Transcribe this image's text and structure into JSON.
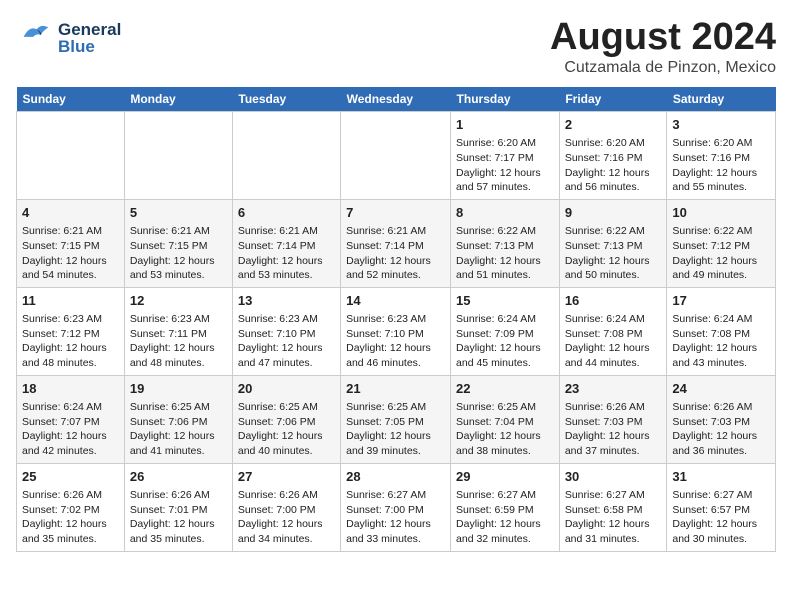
{
  "header": {
    "logo_general": "General",
    "logo_blue": "Blue",
    "month_title": "August 2024",
    "location": "Cutzamala de Pinzon, Mexico"
  },
  "weekdays": [
    "Sunday",
    "Monday",
    "Tuesday",
    "Wednesday",
    "Thursday",
    "Friday",
    "Saturday"
  ],
  "weeks": [
    [
      {
        "day": "",
        "info": ""
      },
      {
        "day": "",
        "info": ""
      },
      {
        "day": "",
        "info": ""
      },
      {
        "day": "",
        "info": ""
      },
      {
        "day": "1",
        "info": "Sunrise: 6:20 AM\nSunset: 7:17 PM\nDaylight: 12 hours\nand 57 minutes."
      },
      {
        "day": "2",
        "info": "Sunrise: 6:20 AM\nSunset: 7:16 PM\nDaylight: 12 hours\nand 56 minutes."
      },
      {
        "day": "3",
        "info": "Sunrise: 6:20 AM\nSunset: 7:16 PM\nDaylight: 12 hours\nand 55 minutes."
      }
    ],
    [
      {
        "day": "4",
        "info": "Sunrise: 6:21 AM\nSunset: 7:15 PM\nDaylight: 12 hours\nand 54 minutes."
      },
      {
        "day": "5",
        "info": "Sunrise: 6:21 AM\nSunset: 7:15 PM\nDaylight: 12 hours\nand 53 minutes."
      },
      {
        "day": "6",
        "info": "Sunrise: 6:21 AM\nSunset: 7:14 PM\nDaylight: 12 hours\nand 53 minutes."
      },
      {
        "day": "7",
        "info": "Sunrise: 6:21 AM\nSunset: 7:14 PM\nDaylight: 12 hours\nand 52 minutes."
      },
      {
        "day": "8",
        "info": "Sunrise: 6:22 AM\nSunset: 7:13 PM\nDaylight: 12 hours\nand 51 minutes."
      },
      {
        "day": "9",
        "info": "Sunrise: 6:22 AM\nSunset: 7:13 PM\nDaylight: 12 hours\nand 50 minutes."
      },
      {
        "day": "10",
        "info": "Sunrise: 6:22 AM\nSunset: 7:12 PM\nDaylight: 12 hours\nand 49 minutes."
      }
    ],
    [
      {
        "day": "11",
        "info": "Sunrise: 6:23 AM\nSunset: 7:12 PM\nDaylight: 12 hours\nand 48 minutes."
      },
      {
        "day": "12",
        "info": "Sunrise: 6:23 AM\nSunset: 7:11 PM\nDaylight: 12 hours\nand 48 minutes."
      },
      {
        "day": "13",
        "info": "Sunrise: 6:23 AM\nSunset: 7:10 PM\nDaylight: 12 hours\nand 47 minutes."
      },
      {
        "day": "14",
        "info": "Sunrise: 6:23 AM\nSunset: 7:10 PM\nDaylight: 12 hours\nand 46 minutes."
      },
      {
        "day": "15",
        "info": "Sunrise: 6:24 AM\nSunset: 7:09 PM\nDaylight: 12 hours\nand 45 minutes."
      },
      {
        "day": "16",
        "info": "Sunrise: 6:24 AM\nSunset: 7:08 PM\nDaylight: 12 hours\nand 44 minutes."
      },
      {
        "day": "17",
        "info": "Sunrise: 6:24 AM\nSunset: 7:08 PM\nDaylight: 12 hours\nand 43 minutes."
      }
    ],
    [
      {
        "day": "18",
        "info": "Sunrise: 6:24 AM\nSunset: 7:07 PM\nDaylight: 12 hours\nand 42 minutes."
      },
      {
        "day": "19",
        "info": "Sunrise: 6:25 AM\nSunset: 7:06 PM\nDaylight: 12 hours\nand 41 minutes."
      },
      {
        "day": "20",
        "info": "Sunrise: 6:25 AM\nSunset: 7:06 PM\nDaylight: 12 hours\nand 40 minutes."
      },
      {
        "day": "21",
        "info": "Sunrise: 6:25 AM\nSunset: 7:05 PM\nDaylight: 12 hours\nand 39 minutes."
      },
      {
        "day": "22",
        "info": "Sunrise: 6:25 AM\nSunset: 7:04 PM\nDaylight: 12 hours\nand 38 minutes."
      },
      {
        "day": "23",
        "info": "Sunrise: 6:26 AM\nSunset: 7:03 PM\nDaylight: 12 hours\nand 37 minutes."
      },
      {
        "day": "24",
        "info": "Sunrise: 6:26 AM\nSunset: 7:03 PM\nDaylight: 12 hours\nand 36 minutes."
      }
    ],
    [
      {
        "day": "25",
        "info": "Sunrise: 6:26 AM\nSunset: 7:02 PM\nDaylight: 12 hours\nand 35 minutes."
      },
      {
        "day": "26",
        "info": "Sunrise: 6:26 AM\nSunset: 7:01 PM\nDaylight: 12 hours\nand 35 minutes."
      },
      {
        "day": "27",
        "info": "Sunrise: 6:26 AM\nSunset: 7:00 PM\nDaylight: 12 hours\nand 34 minutes."
      },
      {
        "day": "28",
        "info": "Sunrise: 6:27 AM\nSunset: 7:00 PM\nDaylight: 12 hours\nand 33 minutes."
      },
      {
        "day": "29",
        "info": "Sunrise: 6:27 AM\nSunset: 6:59 PM\nDaylight: 12 hours\nand 32 minutes."
      },
      {
        "day": "30",
        "info": "Sunrise: 6:27 AM\nSunset: 6:58 PM\nDaylight: 12 hours\nand 31 minutes."
      },
      {
        "day": "31",
        "info": "Sunrise: 6:27 AM\nSunset: 6:57 PM\nDaylight: 12 hours\nand 30 minutes."
      }
    ]
  ]
}
